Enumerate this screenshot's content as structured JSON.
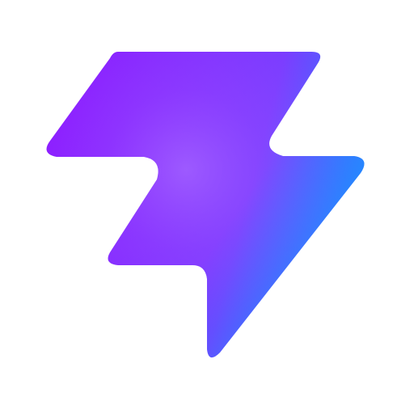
{
  "logo": {
    "icon": "lightning-bolt-icon",
    "colors": {
      "violet": "#8B1CFF",
      "purple_light": "#A55BFF",
      "indigo": "#6A3CFF",
      "blue": "#1E90FF",
      "background": "#ffffff"
    }
  }
}
